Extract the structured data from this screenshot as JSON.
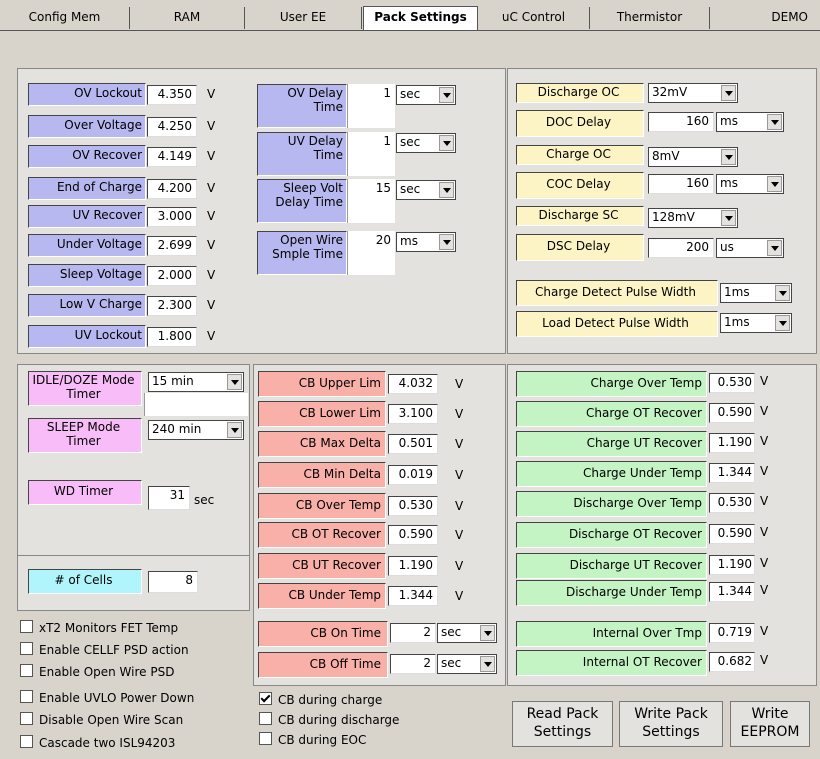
{
  "tabs": [
    "Config Mem",
    "RAM",
    "User EE",
    "Pack Settings",
    "uC Control",
    "Thermistor",
    "DEMO"
  ],
  "voltage": {
    "unit": "V",
    "rows": [
      {
        "label": "OV Lockout",
        "value": "4.350"
      },
      {
        "label": "Over Voltage",
        "value": "4.250"
      },
      {
        "label": "OV Recover",
        "value": "4.149"
      },
      {
        "label": "End of Charge",
        "value": "4.200"
      },
      {
        "label": "UV Recover",
        "value": "3.000"
      },
      {
        "label": "Under Voltage",
        "value": "2.699"
      },
      {
        "label": "Sleep Voltage",
        "value": "2.000"
      },
      {
        "label": "Low V Charge",
        "value": "2.300"
      },
      {
        "label": "UV Lockout",
        "value": "1.800"
      }
    ]
  },
  "delays": [
    {
      "label": "OV Delay Time",
      "value": "1",
      "unit": "sec"
    },
    {
      "label": "UV Delay Time",
      "value": "1",
      "unit": "sec"
    },
    {
      "label": "Sleep Volt Delay Time",
      "value": "15",
      "unit": "sec"
    },
    {
      "label": "Open Wire Smple Time",
      "value": "20",
      "unit": "ms"
    }
  ],
  "current": {
    "discharge_oc": {
      "label": "Discharge OC",
      "value": "32mV"
    },
    "doc_delay": {
      "label": "DOC Delay",
      "value": "160",
      "unit": "ms"
    },
    "charge_oc": {
      "label": "Charge OC",
      "value": "8mV"
    },
    "coc_delay": {
      "label": "COC Delay",
      "value": "160",
      "unit": "ms"
    },
    "discharge_sc": {
      "label": "Discharge SC",
      "value": "128mV"
    },
    "dsc_delay": {
      "label": "DSC Delay",
      "value": "200",
      "unit": "us"
    },
    "charge_pulse": {
      "label": "Charge Detect Pulse Width",
      "value": "1ms"
    },
    "load_pulse": {
      "label": "Load Detect Pulse Width",
      "value": "1ms"
    }
  },
  "timers": {
    "idle": {
      "label": "IDLE/DOZE Mode Timer",
      "value": "15 min"
    },
    "sleep": {
      "label": "SLEEP Mode Timer",
      "value": "240 min"
    },
    "wd": {
      "label": "WD Timer",
      "value": "31",
      "unit": "sec"
    }
  },
  "cells": {
    "label": "# of Cells",
    "value": "8"
  },
  "options": [
    {
      "label": "xT2 Monitors FET Temp",
      "checked": false
    },
    {
      "label": "Enable CELLF PSD action",
      "checked": false
    },
    {
      "label": "Enable Open Wire PSD",
      "checked": false
    },
    {
      "label": "Enable UVLO Power Down",
      "checked": false
    },
    {
      "label": "Disable Open Wire Scan",
      "checked": false
    },
    {
      "label": "Cascade two ISL94203",
      "checked": false
    }
  ],
  "cb": {
    "unit": "V",
    "rows": [
      {
        "label": "CB Upper Lim",
        "value": "4.032"
      },
      {
        "label": "CB Lower Lim",
        "value": "3.100"
      },
      {
        "label": "CB Max Delta",
        "value": "0.501"
      },
      {
        "label": "CB Min Delta",
        "value": "0.019"
      },
      {
        "label": "CB Over Temp",
        "value": "0.530"
      },
      {
        "label": "CB OT Recover",
        "value": "0.590"
      },
      {
        "label": "CB UT Recover",
        "value": "1.190"
      },
      {
        "label": "CB Under Temp",
        "value": "1.344"
      }
    ],
    "on_time": {
      "label": "CB On Time",
      "value": "2",
      "unit": "sec"
    },
    "off_time": {
      "label": "CB Off Time",
      "value": "2",
      "unit": "sec"
    },
    "checks": [
      {
        "label": "CB during charge",
        "checked": true
      },
      {
        "label": "CB during discharge",
        "checked": false
      },
      {
        "label": "CB during EOC",
        "checked": false
      }
    ]
  },
  "temps": {
    "unit": "V",
    "rows": [
      {
        "label": "Charge Over Temp",
        "value": "0.530"
      },
      {
        "label": "Charge OT Recover",
        "value": "0.590"
      },
      {
        "label": "Charge UT Recover",
        "value": "1.190"
      },
      {
        "label": "Charge Under Temp",
        "value": "1.344"
      },
      {
        "label": "Discharge Over Temp",
        "value": "0.530"
      },
      {
        "label": "Discharge OT Recover",
        "value": "0.590"
      },
      {
        "label": "Discharge UT Recover",
        "value": "1.190"
      },
      {
        "label": "Discharge Under Temp",
        "value": "1.344"
      }
    ],
    "internal": [
      {
        "label": "Internal Over Tmp",
        "value": "0.719"
      },
      {
        "label": "Internal OT Recover",
        "value": "0.682"
      }
    ]
  },
  "buttons": {
    "read": "Read Pack Settings",
    "write": "Write Pack Settings",
    "eeprom": "Write EEPROM"
  },
  "colors": {
    "voltage": "#b8b8f0",
    "current": "#fcf4c4",
    "timer": "#f8bcf8",
    "cb": "#f8b0a8",
    "temp": "#c4f4c4",
    "cells": "#b0f4fc"
  }
}
